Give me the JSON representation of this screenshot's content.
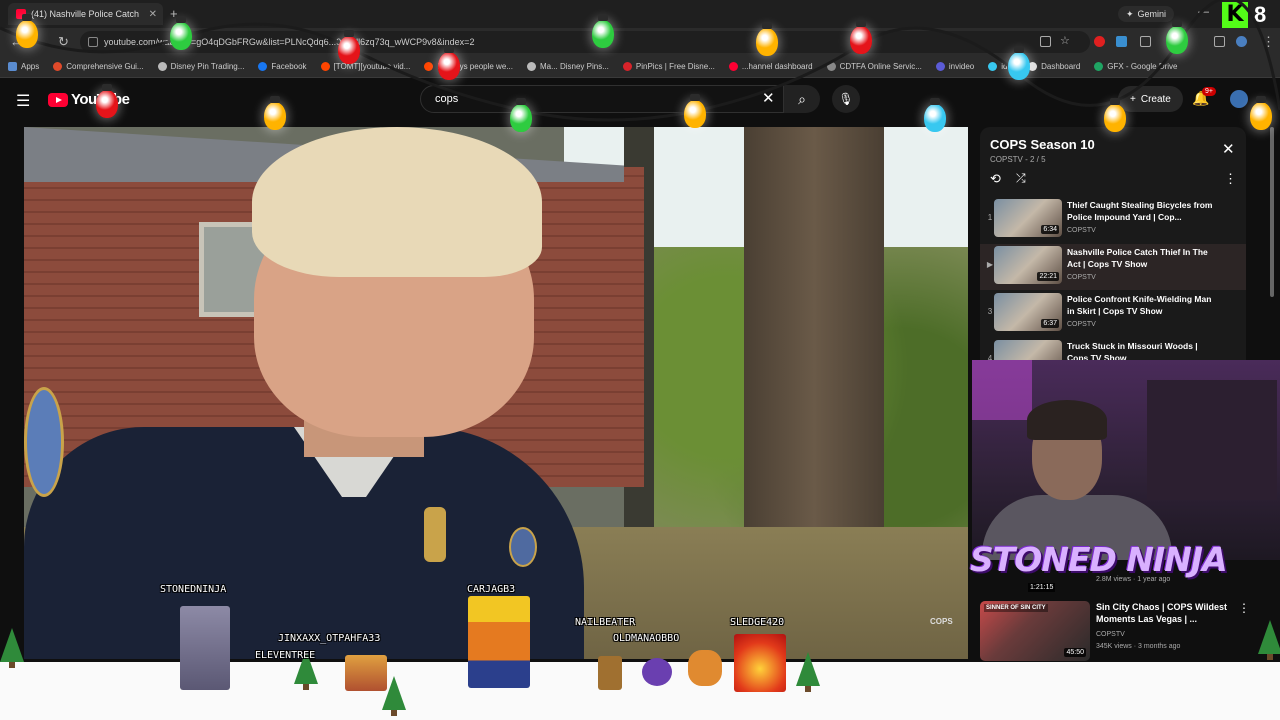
{
  "browser": {
    "tab_title": "(41) Nashville Police Catch",
    "url": "youtube.com/watch?v=gO4qDGbFRGw&list=PLNcQdq6...0pbldl6zq73q_wWCP9v8&index=2",
    "gemini_label": "Gemini",
    "kick_count": "8",
    "bookmarks": [
      "Apps",
      "Comprehensive Gui...",
      "Disney Pin Trading...",
      "Facebook",
      "[TOMT][youtube vid...",
      "If todays people we...",
      "Ma... Disney Pins...",
      "PinPics | Free Disne...",
      "...hannel dashboard",
      "CDTFA Online Servic...",
      "invideo",
      "id...",
      "Dashboard",
      "GFX - Google Drive"
    ]
  },
  "youtube": {
    "logo_text": "YouTube",
    "search_value": "cops",
    "create_label": "Create",
    "notif_badge": "9+"
  },
  "playlist": {
    "title": "COPS Season 10",
    "subtitle": "COPSTV - 2 / 5",
    "items": [
      {
        "index": "1",
        "title": "Thief Caught Stealing Bicycles from Police Impound Yard | Cop...",
        "channel": "COPSTV",
        "duration": "6:34"
      },
      {
        "index": "▶",
        "title": "Nashville Police Catch Thief In The Act | Cops TV Show",
        "channel": "COPSTV",
        "duration": "22:21"
      },
      {
        "index": "3",
        "title": "Police Confront Knife-Wielding Man in Skirt | Cops TV Show",
        "channel": "COPSTV",
        "duration": "6:37"
      },
      {
        "index": "4",
        "title": "Truck Stuck in Missouri Woods | Cops TV Show",
        "channel": "COPSTV",
        "duration": ""
      }
    ]
  },
  "overlay": {
    "banner": "STONED NINJA",
    "chat_names": [
      "STONEDNINJA",
      "JINXAXX_OTPAHFA33",
      "ELEVENTREE",
      "CARJAGB3",
      "NAILBEATER",
      "OLDMANAOBBO",
      "SLEDGE420"
    ]
  },
  "recommended": {
    "faded_duration": "1:21:15",
    "faded_meta": "2.8M views · 1 year ago",
    "thumb_label": "SINNER OF SIN CITY",
    "title": "Sin City Chaos | COPS Wildest Moments Las Vegas | ...",
    "channel": "COPSTV",
    "meta": "345K views · 3 months ago",
    "duration": "45:50"
  },
  "video": {
    "watermark": "COPS"
  },
  "colors": {
    "bulb_colors": [
      "#ffb300",
      "#2ecc40",
      "#e5141a",
      "#38c8f0"
    ],
    "accent": "#ff0033",
    "kick": "#53fc18"
  }
}
